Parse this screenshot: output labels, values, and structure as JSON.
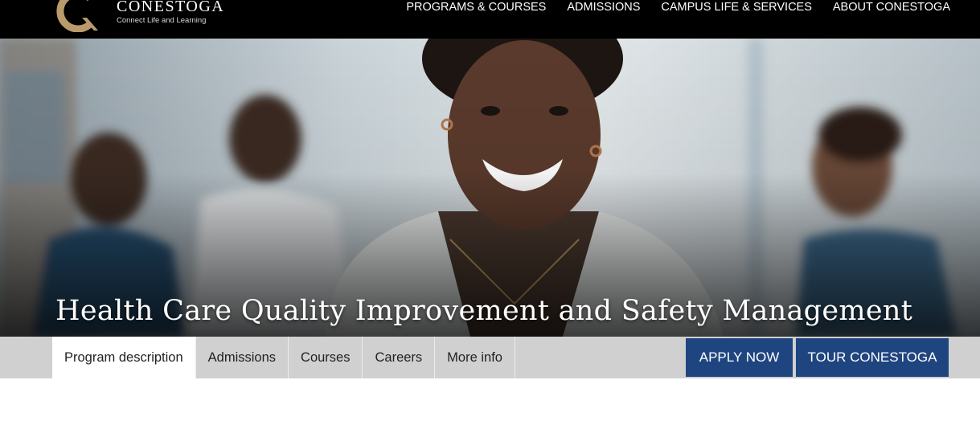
{
  "header": {
    "logo_name": "CONESTOGA",
    "logo_tagline": "Connect Life and Learning",
    "nav": [
      {
        "label": "PROGRAMS & COURSES"
      },
      {
        "label": "ADMISSIONS"
      },
      {
        "label": "CAMPUS LIFE & SERVICES"
      },
      {
        "label": "ABOUT CONESTOGA"
      }
    ]
  },
  "hero": {
    "title": "Health Care Quality Improvement and Safety Management"
  },
  "program_tabs": [
    {
      "label": "Program description",
      "active": true
    },
    {
      "label": "Admissions",
      "active": false
    },
    {
      "label": "Courses",
      "active": false
    },
    {
      "label": "Careers",
      "active": false
    },
    {
      "label": "More info",
      "active": false
    }
  ],
  "actions": {
    "apply_label": "APPLY NOW",
    "tour_label": "TOUR CONESTOGA"
  },
  "colors": {
    "topbar": "#000000",
    "logo_gold": "#b99a6b",
    "tab_bar": "#d0d0d0",
    "cta_blue": "#1f4580"
  },
  "icons": {
    "logo": "conestoga-c-logo-icon"
  }
}
